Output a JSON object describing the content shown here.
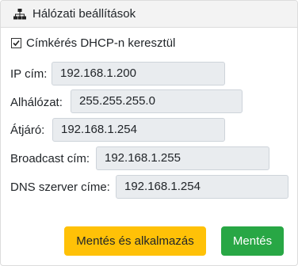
{
  "header": {
    "icon": "sitemap-icon",
    "title": "Hálózati beállítások"
  },
  "dhcp": {
    "label": "Címkérés DHCP-n keresztül",
    "checked": true
  },
  "fields": [
    {
      "label": "IP cím:",
      "value": "192.168.1.200"
    },
    {
      "label": "Alhálózat:",
      "value": "255.255.255.0"
    },
    {
      "label": "Átjáró:",
      "value": "192.168.1.254"
    },
    {
      "label": "Broadcast cím:",
      "value": "192.168.1.255"
    },
    {
      "label": "DNS szerver címe:",
      "value": "192.168.1.254"
    }
  ],
  "buttons": {
    "save_apply": "Mentés és alkalmazás",
    "save": "Mentés"
  },
  "colors": {
    "warning": "#ffc107",
    "success": "#28a745",
    "input_disabled_bg": "#e9ecef"
  }
}
